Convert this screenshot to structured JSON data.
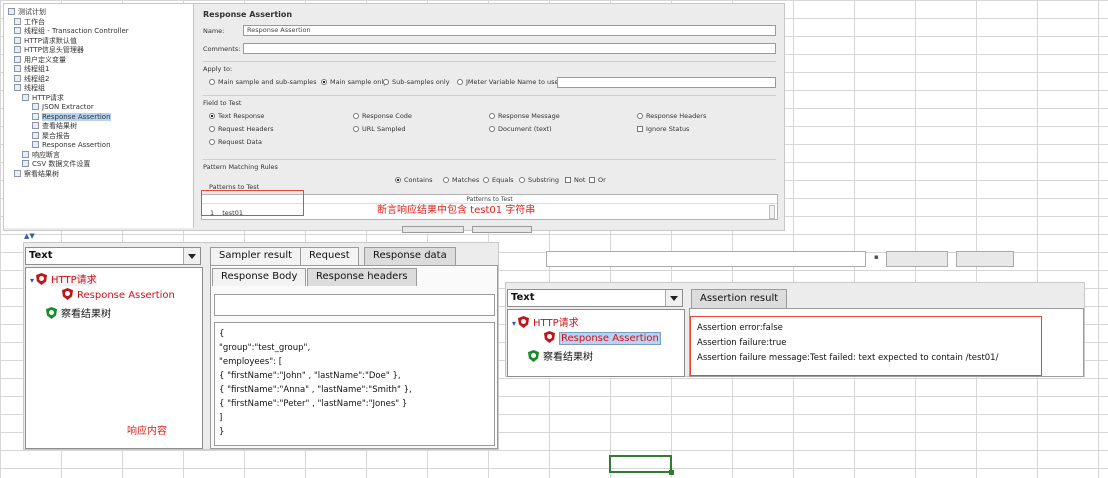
{
  "top_panel": {
    "tree_items": [
      {
        "label": "测试计划"
      },
      {
        "label": "工作台"
      },
      {
        "label": "线程组 - Transaction Controller"
      },
      {
        "label": "HTTP请求默认值"
      },
      {
        "label": "HTTP信息头管理器"
      },
      {
        "label": "用户定义变量"
      },
      {
        "label": "线程组1"
      },
      {
        "label": "线程组2"
      },
      {
        "label": "线程组"
      },
      {
        "label": "HTTP请求"
      },
      {
        "label": "JSON Extractor"
      },
      {
        "label": "Response Assertion"
      },
      {
        "label": "查看结果树"
      },
      {
        "label": "聚合报告"
      },
      {
        "label": "Response Assertion"
      },
      {
        "label": "响应断言"
      },
      {
        "label": "CSV 数据文件设置"
      },
      {
        "label": "察看结果树"
      }
    ],
    "form_title": "Response Assertion",
    "name_label": "Name:",
    "name_value": "Response Assertion",
    "comments_label": "Comments:",
    "apply_to": {
      "title": "Apply to:",
      "options": [
        "Main sample and sub-samples",
        "Main sample only",
        "Sub-samples only",
        "JMeter Variable Name to use"
      ]
    },
    "field_to_test": {
      "title": "Field to Test",
      "options": [
        "Text Response",
        "Response Code",
        "Response Message",
        "Response Headers",
        "Request Headers",
        "URL Sampled",
        "Document (text)",
        "Ignore Status",
        "Request Data"
      ]
    },
    "pattern_rules": {
      "title": "Pattern Matching Rules",
      "options": [
        "Contains",
        "Matches",
        "Equals",
        "Substring",
        "Not",
        "Or"
      ]
    },
    "patterns_to_test": {
      "title": "Patterns to Test",
      "header": "Patterns to Test",
      "row_index": "1",
      "row_value": "test01"
    },
    "annotation": "断言响应结果中包含 test01 字符串"
  },
  "bottom_left": {
    "combo_value": "Text",
    "tree": {
      "http_request": "HTTP请求",
      "assertion": "Response Assertion",
      "result_tree": "察看结果树"
    },
    "tabs": [
      "Sampler result",
      "Request",
      "Response data"
    ],
    "subtabs": [
      "Response Body",
      "Response headers"
    ],
    "response_lines": [
      "{",
      "\"group\":\"test_group\",",
      "\"employees\": [",
      "{ \"firstName\":\"John\" , \"lastName\":\"Doe\" },",
      "{ \"firstName\":\"Anna\" , \"lastName\":\"Smith\" },",
      "{ \"firstName\":\"Peter\" , \"lastName\":\"Jones\" }",
      "]",
      "}"
    ],
    "annotation": "响应内容"
  },
  "bottom_right": {
    "combo_value": "Text",
    "tree": {
      "http_request": "HTTP请求",
      "assertion": "Response Assertion",
      "result_tree": "察看结果树"
    },
    "tab": "Assertion result",
    "result_lines": [
      "Assertion error:false",
      "Assertion failure:true",
      "Assertion failure message:Test failed: text expected to contain /test01/"
    ]
  },
  "colors": {
    "annotation_red": "#e0201a",
    "excel_selection": "#2e7d32"
  }
}
